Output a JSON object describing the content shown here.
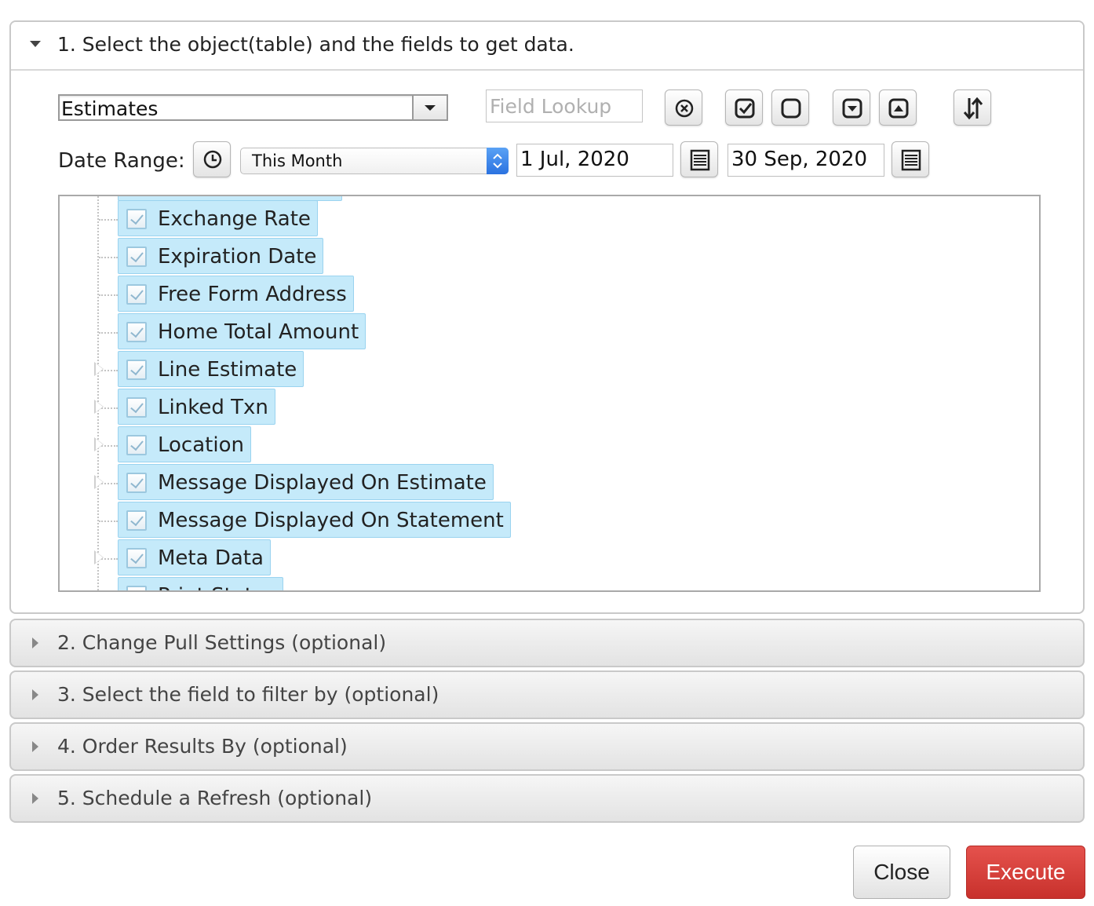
{
  "section1": {
    "title": "1. Select the object(table) and the fields to get data."
  },
  "object_select": {
    "value": "Estimates"
  },
  "field_lookup": {
    "placeholder": "Field Lookup"
  },
  "toolbar_icons": [
    "clear-icon",
    "check-all-icon",
    "uncheck-all-icon",
    "expand-all-icon",
    "collapse-all-icon",
    "sort-icon"
  ],
  "date_range": {
    "label": "Date Range:",
    "period": "This Month",
    "from": "1 Jul, 2020",
    "to": "30 Sep, 2020"
  },
  "fields": [
    {
      "label": "Exchange Rate",
      "expandable": false
    },
    {
      "label": "Expiration Date",
      "expandable": false
    },
    {
      "label": "Free Form Address",
      "expandable": false
    },
    {
      "label": "Home Total Amount",
      "expandable": false
    },
    {
      "label": "Line Estimate",
      "expandable": true
    },
    {
      "label": "Linked Txn",
      "expandable": true
    },
    {
      "label": "Location",
      "expandable": true
    },
    {
      "label": "Message Displayed On Estimate",
      "expandable": true
    },
    {
      "label": "Message Displayed On Statement",
      "expandable": false
    },
    {
      "label": "Meta Data",
      "expandable": true
    },
    {
      "label": "Print Status",
      "expandable": false
    }
  ],
  "sections": [
    {
      "title": "2. Change Pull Settings (optional)"
    },
    {
      "title": "3. Select the field to filter by (optional)"
    },
    {
      "title": "4. Order Results By (optional)"
    },
    {
      "title": "5. Schedule a Refresh (optional)"
    }
  ],
  "buttons": {
    "close": "Close",
    "execute": "Execute"
  },
  "colors": {
    "selected_field_bg": "#c5eafa",
    "execute_bg": "#d33f3a",
    "stepper_blue": "#2b72e0"
  }
}
